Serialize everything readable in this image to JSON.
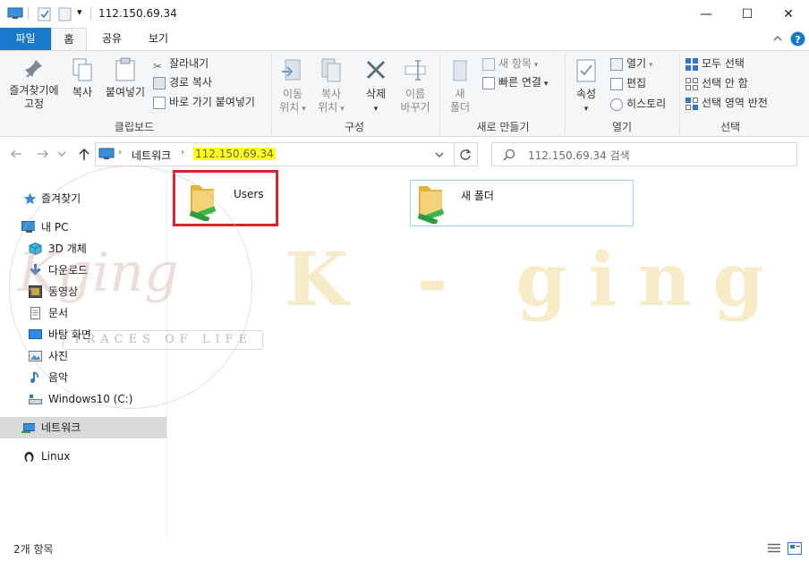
{
  "window": {
    "title": "112.150.69.34",
    "qa_dropdown_glyph": "▾",
    "controls": {
      "minimize": "—",
      "maximize": "☐",
      "close": "✕"
    }
  },
  "ribbon_tabs": [
    "파일",
    "홈",
    "공유",
    "보기"
  ],
  "ribbon": {
    "clipboard": {
      "pin_line1": "즐겨찾기에",
      "pin_line2": "고정",
      "copy": "복사",
      "paste": "붙여넣기",
      "cut": "잘라내기",
      "copy_path": "경로 복사",
      "paste_shortcut": "바로 가기 붙여넣기",
      "group": "클립보드"
    },
    "organize": {
      "move_to_1": "이동",
      "move_to_2": "위치",
      "copy_to_1": "복사",
      "copy_to_2": "위치",
      "delete": "삭제",
      "rename_1": "이름",
      "rename_2": "바꾸기",
      "group": "구성"
    },
    "new": {
      "new_folder_1": "새",
      "new_folder_2": "폴더",
      "new_item": "새 항목",
      "easy_access": "빠른 연결",
      "group": "새로 만들기"
    },
    "open": {
      "properties": "속성",
      "open": "열기",
      "edit": "편집",
      "history": "히스토리",
      "group": "열기"
    },
    "select": {
      "select_all": "모두 선택",
      "select_none": "선택 안 함",
      "invert": "선택 영역 반전",
      "group": "선택"
    }
  },
  "address": {
    "crumbs": [
      "네트워크",
      "112.150.69.34"
    ],
    "search_placeholder": "112.150.69.34 검색"
  },
  "sidebar": [
    {
      "label": "즐겨찾기",
      "icon": "star-icon"
    },
    {
      "label": "내 PC",
      "icon": "pc-icon"
    },
    {
      "label": "3D 개체",
      "icon": "cube-icon"
    },
    {
      "label": "다운로드",
      "icon": "download-icon"
    },
    {
      "label": "동영상",
      "icon": "video-icon"
    },
    {
      "label": "문서",
      "icon": "document-icon"
    },
    {
      "label": "바탕 화면",
      "icon": "desktop-icon"
    },
    {
      "label": "사진",
      "icon": "picture-icon"
    },
    {
      "label": "음악",
      "icon": "music-icon"
    },
    {
      "label": "Windows10 (C:)",
      "icon": "drive-icon"
    },
    {
      "label": "네트워크",
      "icon": "network-icon"
    },
    {
      "label": "Linux",
      "icon": "linux-icon"
    }
  ],
  "items": [
    {
      "name": "Users",
      "type": "shared-folder"
    },
    {
      "name": "새 폴더",
      "type": "shared-folder"
    }
  ],
  "status": {
    "count": "2개 항목"
  },
  "watermark": {
    "brand": "K - ging",
    "script": "Kging",
    "tagline": "TRACES OF LIFE"
  },
  "colors": {
    "accent": "#1979ca",
    "highlight_box": "#d9232e",
    "selection": "#cce8ff",
    "watermark": "#f3dc9a"
  }
}
